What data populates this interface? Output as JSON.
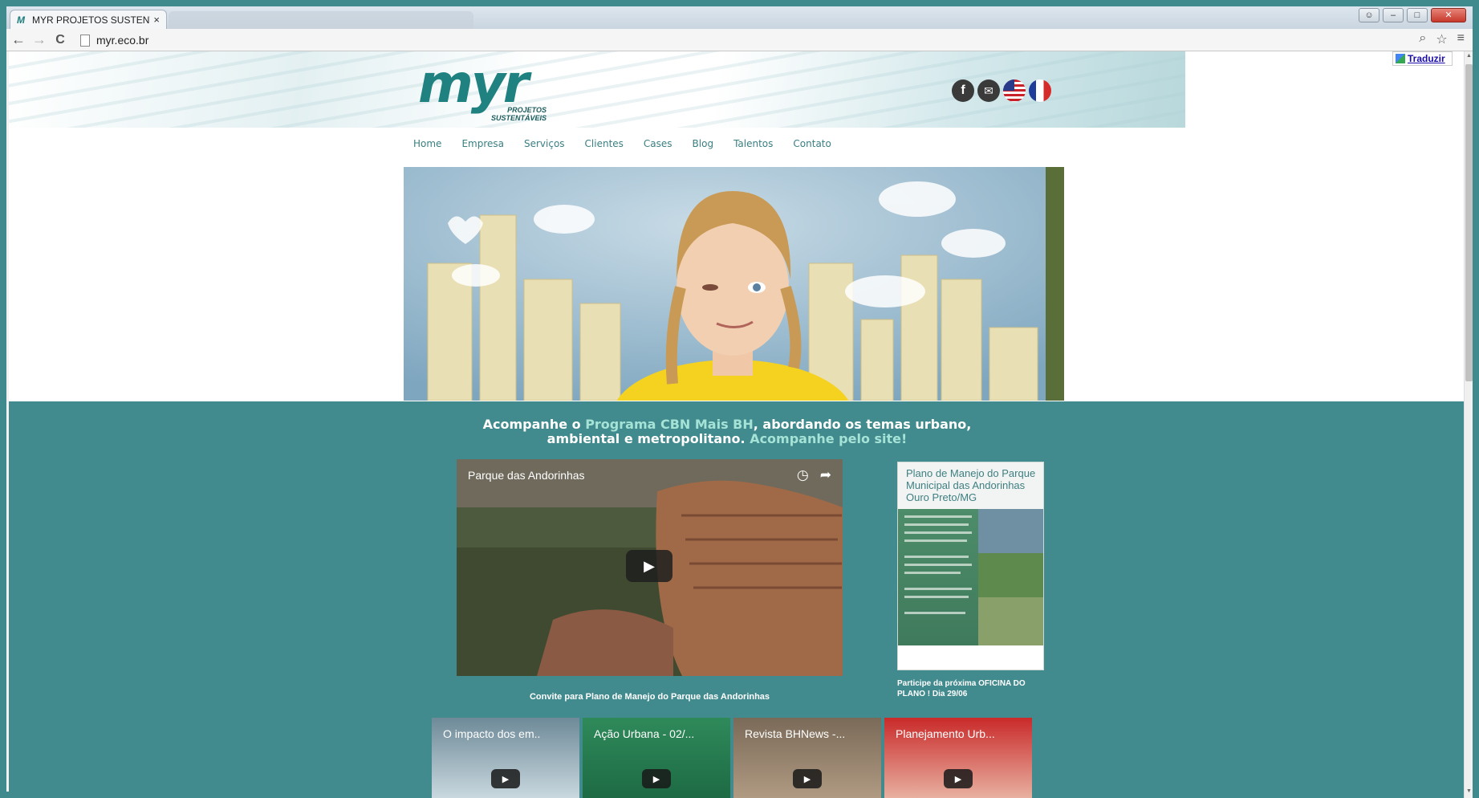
{
  "browser": {
    "tab_title": "MYR PROJETOS SUSTENT",
    "tab_close": "×",
    "url": "myr.eco.br",
    "back": "←",
    "forward": "→",
    "reload": "C"
  },
  "site": {
    "logo_text": "myr",
    "logo_sub_line1": "PROJETOS",
    "logo_sub_line2": "SUSTENTÁVEIS",
    "translate_label": "Traduzir",
    "nav": [
      "Home",
      "Empresa",
      "Serviços",
      "Clientes",
      "Cases",
      "Blog",
      "Talentos",
      "Contato"
    ],
    "social_icons": [
      "facebook-icon",
      "mail-icon",
      "us-flag-icon",
      "france-flag-icon"
    ]
  },
  "program": {
    "text_1": "Acompanhe o ",
    "link_1": "Programa CBN Mais BH",
    "text_2": ", abordando os temas urbano, ambiental e metropolitano. ",
    "link_2": "Acompanhe pelo site!"
  },
  "video": {
    "title": "Parque das Andorinhas",
    "caption": "Convite para Plano de Manejo do Parque das Andorinhas"
  },
  "poster": {
    "title": "Plano de Manejo do Parque Municipal das Andorinhas Ouro Preto/MG",
    "caption": "Participe da próxima OFICINA DO PLANO ! Dia 29/06"
  },
  "thumbnails": [
    {
      "title": "O impacto dos em.."
    },
    {
      "title": "Ação Urbana - 02/..."
    },
    {
      "title": "Revista BHNews -..."
    },
    {
      "title": "Planejamento Urb..."
    }
  ],
  "colors": {
    "teal": "#418a8d",
    "link_light": "#a6e3d7",
    "nav_text": "#3a7f82"
  }
}
